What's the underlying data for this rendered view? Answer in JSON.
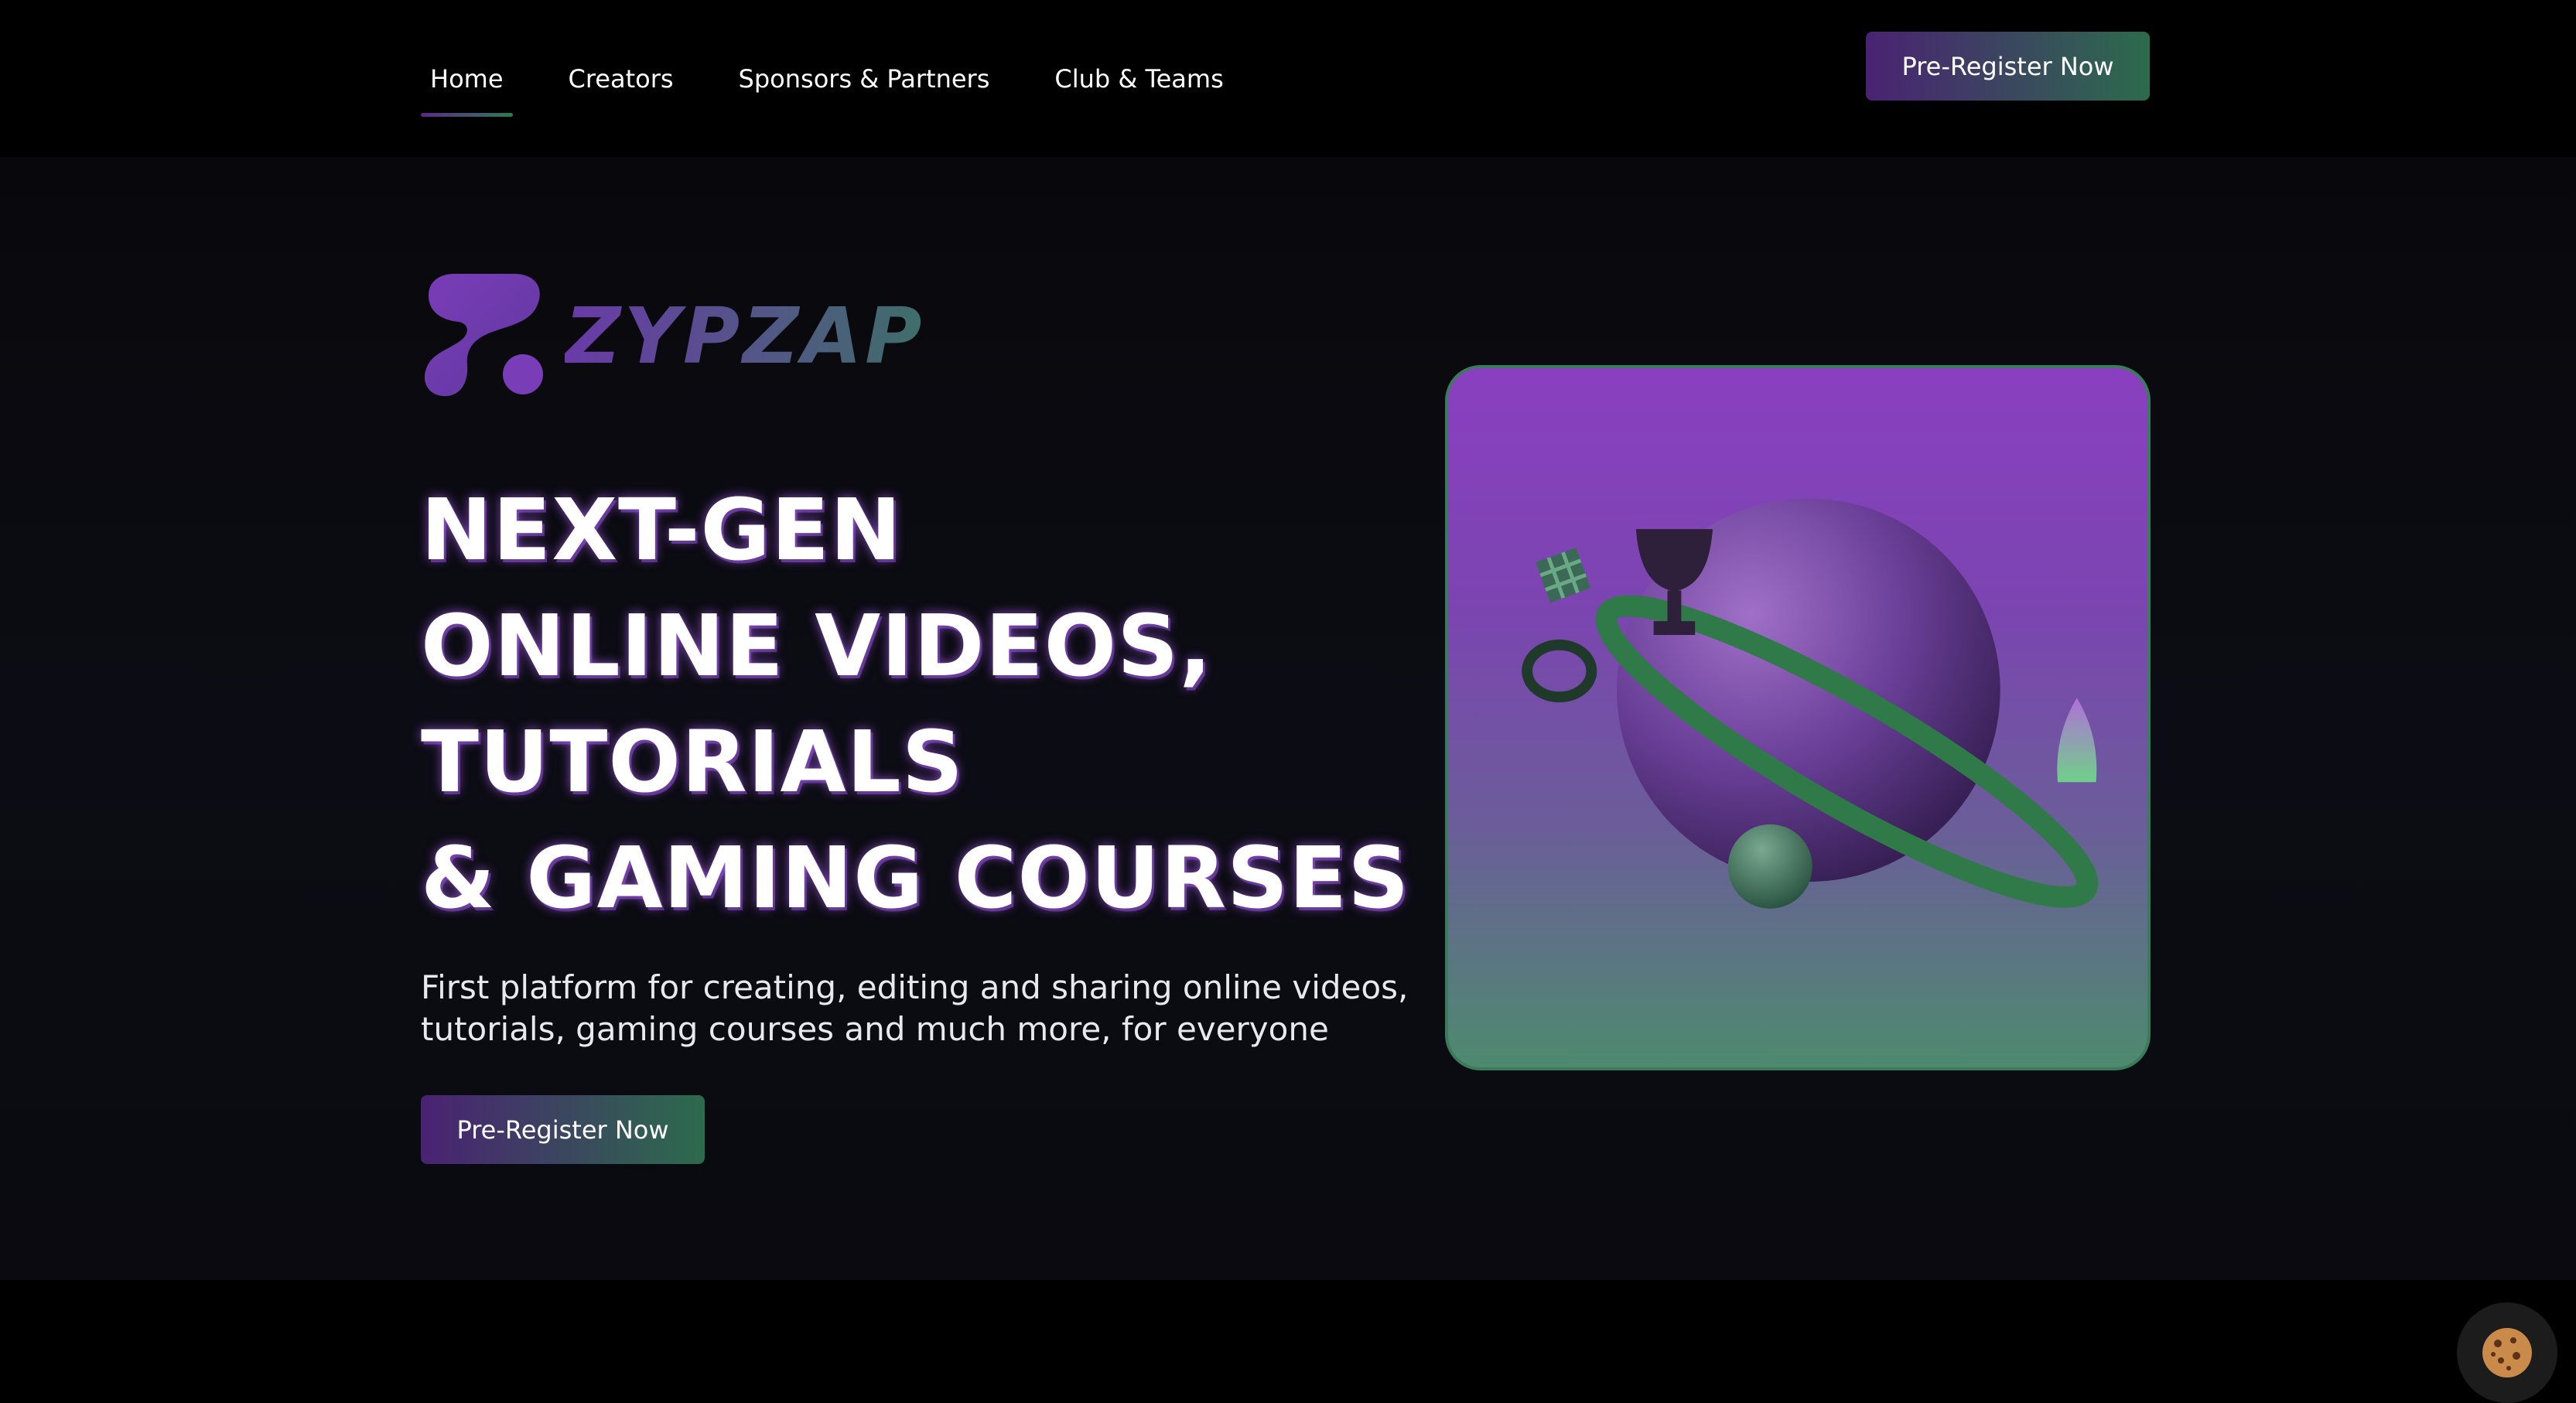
{
  "nav": {
    "items": [
      {
        "label": "Home",
        "active": true
      },
      {
        "label": "Creators",
        "active": false
      },
      {
        "label": "Sponsors & Partners",
        "active": false
      },
      {
        "label": "Club & Teams",
        "active": false
      }
    ],
    "cta_label": "Pre-Register Now"
  },
  "hero": {
    "logo_text": "ZYPZAP",
    "headline": [
      "NEXT-GEN",
      "ONLINE VIDEOS,",
      "TUTORIALS",
      "& GAMING COURSES"
    ],
    "subtext": "First platform for creating, editing and sharing online videos, tutorials, gaming courses and much more, for everyone",
    "cta_label": "Pre-Register Now",
    "image_icon": "planet-illustration"
  },
  "cookie": {
    "icon": "cookie-icon"
  },
  "colors": {
    "background": "#000000",
    "accent_purple": "#4a2273",
    "accent_green": "#2c6b4c"
  }
}
